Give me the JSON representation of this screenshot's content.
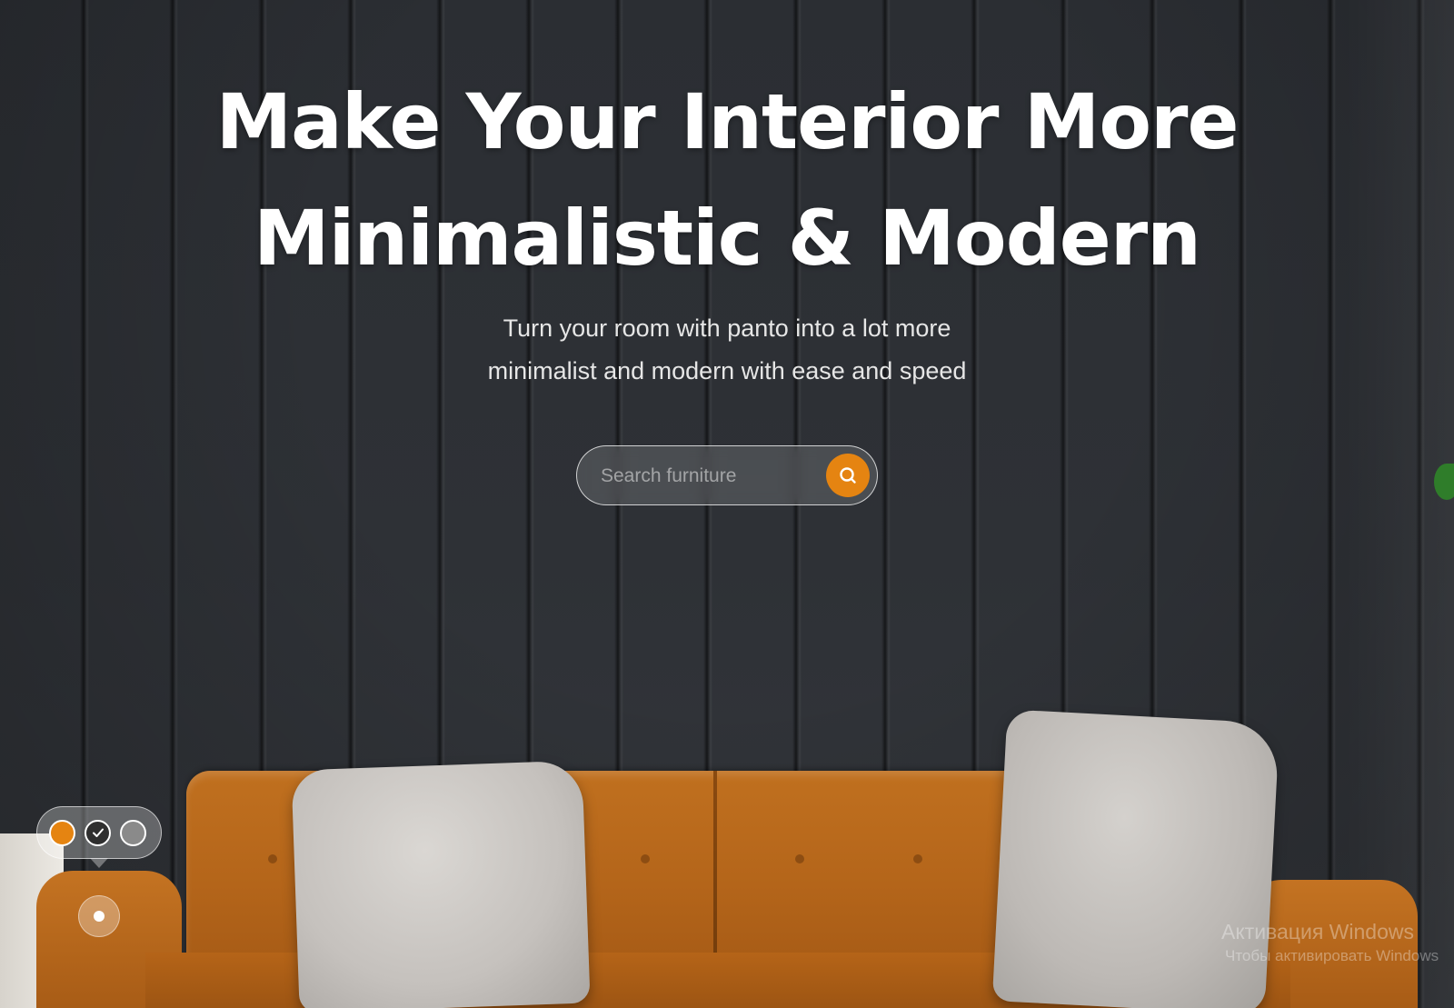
{
  "hero": {
    "title_line1": "Make Your Interior More",
    "title_line2": "Minimalistic & Modern",
    "subtitle_line1": "Turn your room with panto into a lot more",
    "subtitle_line2": "minimalist and modern with ease and speed"
  },
  "search": {
    "placeholder": "Search furniture",
    "button_icon": "search-icon",
    "button_color": "#e58411"
  },
  "color_picker": {
    "swatches": [
      {
        "color": "#e58411",
        "icon": "circle-icon"
      },
      {
        "color": "#2f2f2f",
        "icon": "check-icon"
      },
      {
        "color": "#8a8a8a",
        "icon": "circle-icon"
      }
    ],
    "hotspot_icon": "dot-icon"
  },
  "watermark": {
    "title": "Активация Windows",
    "subtitle": "Чтобы активировать Windows"
  },
  "colors": {
    "accent": "#e58411",
    "wall": "#2b2e33",
    "sofa": "#b4651a"
  }
}
